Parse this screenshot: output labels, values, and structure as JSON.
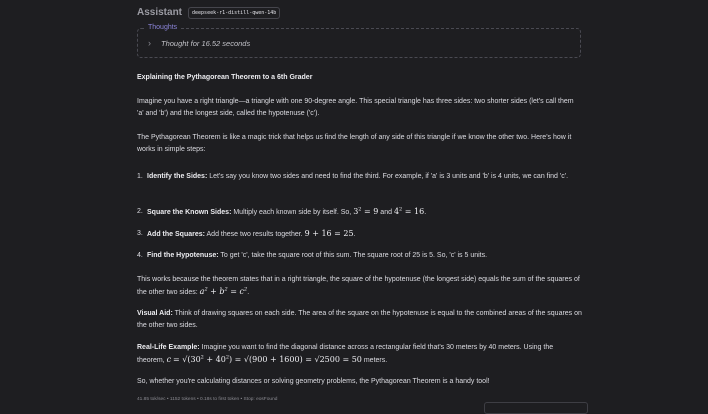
{
  "header": {
    "role": "Assistant",
    "model": "deepseek-r1-distill-qwen-14b"
  },
  "thoughts": {
    "label": "Thoughts",
    "time": "Thought for 16.52 seconds"
  },
  "title": "Explaining the Pythagorean Theorem to a 6th Grader",
  "paragraphs": {
    "intro": "Imagine you have a right triangle—a triangle with one 90-degree angle. This special triangle has three sides: two shorter sides (let's call them 'a' and 'b') and the longest side, called the hypotenuse ('c').",
    "magic": "The Pythagorean Theorem is like a magic trick that helps us find the length of any side of this triangle if we know the other two. Here's how it works in simple steps:",
    "works": "This works because the theorem states that in a right triangle, the square of the hypotenuse (the longest side) equals the sum of the squares of the other two sides: ",
    "visual_label": "Visual Aid:",
    "visual": " Think of drawing squares on each side. The area of the square on the hypotenuse is equal to the combined areas of the squares on the other two sides.",
    "real_label": "Real-Life Example:",
    "real": " Imagine you want to find the diagonal distance across a rectangular field that's 30 meters by 40 meters. Using the theorem, ",
    "closing": "So, whether you're calculating distances or solving geometry problems, the Pythagorean Theorem is a handy tool!"
  },
  "steps": [
    {
      "num": "1.",
      "title": "Identify the Sides:",
      "text": " Let's say you know two sides and need to find the third. For example, if 'a' is 3 units and 'b' is 4 units, we can find 'c'."
    },
    {
      "num": "2.",
      "title": "Square the Known Sides:",
      "text": " Multiply each known side by itself. So, "
    },
    {
      "num": "3.",
      "title": "Add the Squares:",
      "text": " Add these two results together. "
    },
    {
      "num": "4.",
      "title": "Find the Hypotenuse:",
      "text": " To get 'c', take the square root of this sum. The square root of 25 is 5. So, 'c' is 5 units."
    }
  ],
  "stats": "41.85 tok/sec  •  1152 tokens  •  0.18s to first token  •  Stop: eosFound"
}
